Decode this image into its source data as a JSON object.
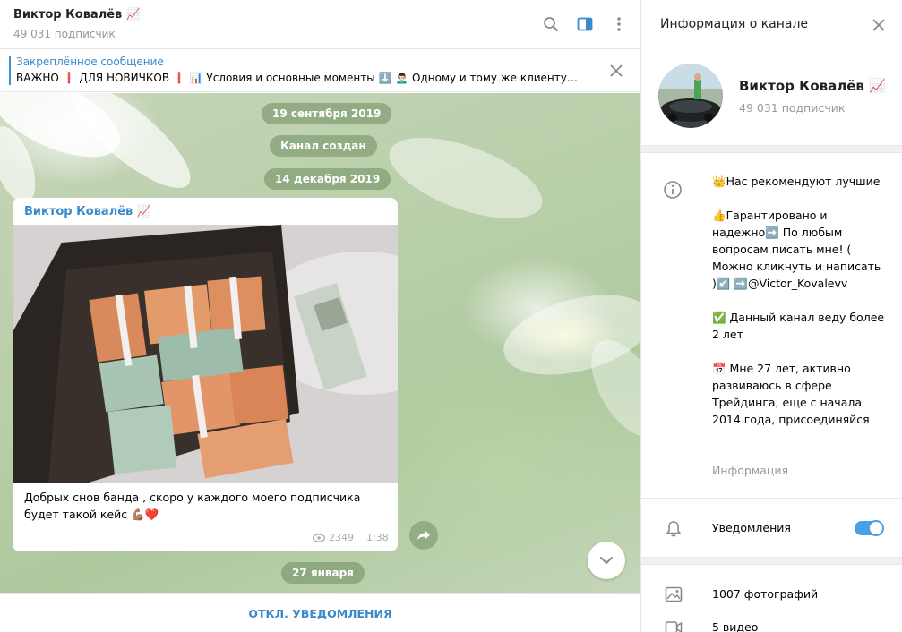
{
  "chat": {
    "title": "Виктор Ковалёв 📈",
    "subtitle": "49 031 подписчик",
    "pinned": {
      "title": "Закреплённое сообщение",
      "text": "ВАЖНО ❗ ДЛЯ НОВИЧКОВ ❗ 📊 Условия и основные моменты ⬇️ 🙍🏻‍♂️ Одному и тому же клиенту…"
    },
    "dates": [
      "19 сентября 2019",
      "Канал создан",
      "14 декабря 2019",
      "27 января"
    ],
    "message": {
      "author": "Виктор Ковалёв 📈",
      "text": "Добрых снов банда , скоро у каждого моего подписчика будет такой кейс 💪🏽❤️",
      "views": "2349",
      "time": "1:38"
    },
    "footer_button": "ОТКЛ. УВЕДОМЛЕНИЯ"
  },
  "info": {
    "title": "Информация о канале",
    "channel_name": "Виктор Ковалёв 📈",
    "subscribers": "49 031 подписчик",
    "description": [
      "👑Нас рекомендуют лучшие",
      "👍Гарантировано и надежно➡️ По любым вопросам писать мне! ( Можно кликнуть и написать )↙️ ➡️@Victor_Kovalevv",
      "✅ Данный канал веду более 2 лет",
      "📅 Мне 27 лет, активно развиваюсь в сфере Трейдинга, еще с начала 2014 года, присоединяйся"
    ],
    "description_label": "Информация",
    "notifications_label": "Уведомления",
    "notifications_on": true,
    "media": [
      {
        "label": "1007 фотографий",
        "icon": "photo-icon"
      },
      {
        "label": "5 видео",
        "icon": "video-icon"
      }
    ]
  },
  "colors": {
    "accent": "#3a8acb",
    "toggle": "#47a1e4",
    "muted_text": "#999999",
    "date_pill_bg": "rgba(110,140,95,0.55)"
  }
}
